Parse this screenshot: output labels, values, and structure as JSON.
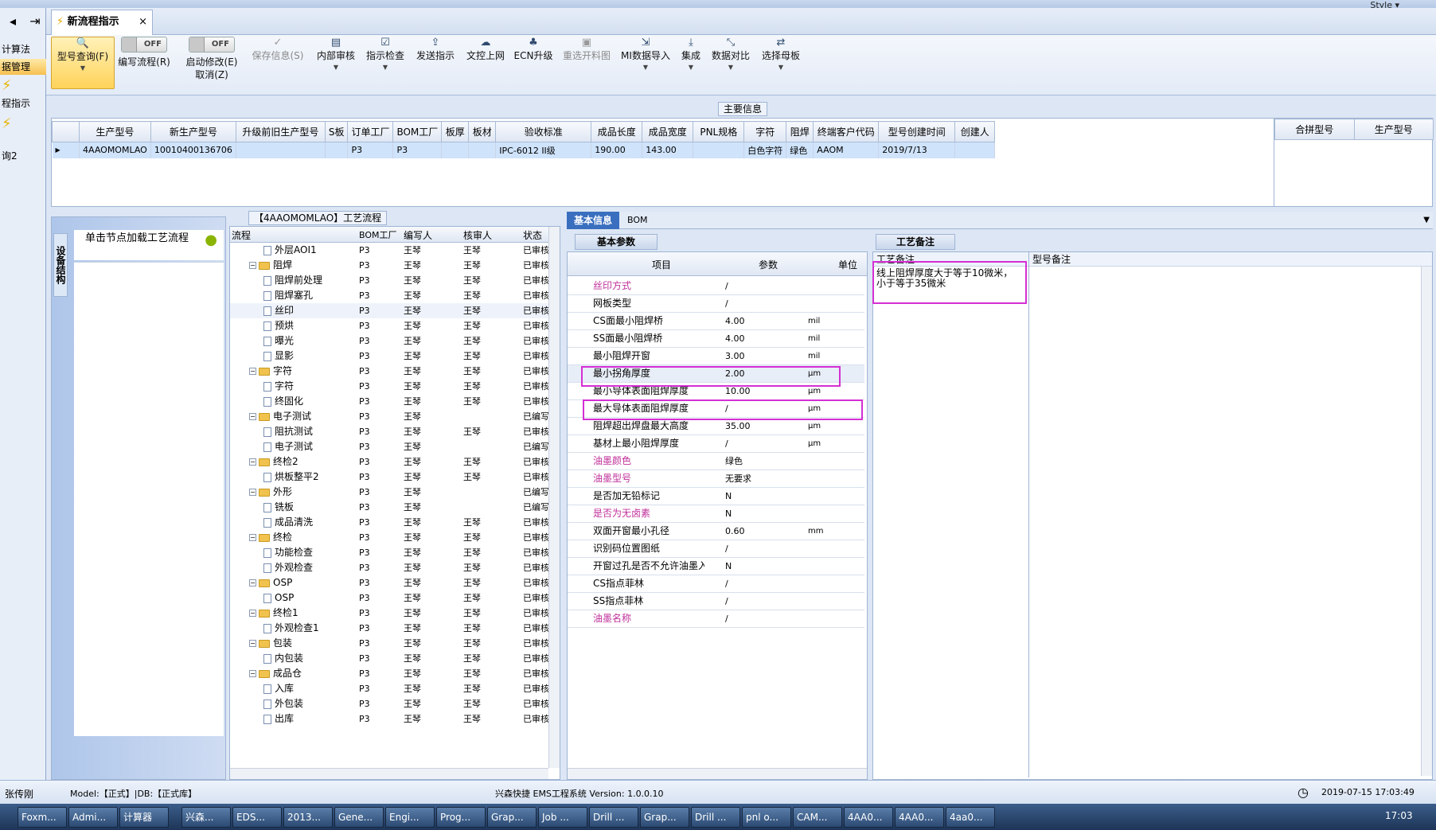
{
  "window": {
    "style_label": "Style ▾"
  },
  "leftnav": {
    "items": [
      "计算法",
      "据管理",
      "程指示",
      "询2"
    ],
    "icon_1": "lightning-icon",
    "icon_2": "lightning-icon"
  },
  "tabstrip": {
    "back": "◂",
    "forward": "⇥",
    "tab_label": "新流程指示",
    "close": "×"
  },
  "ribbon": {
    "query": "型号查询(F)",
    "write_flow": "编写流程(R)",
    "start_modify": "启动修改(E)",
    "cancel": "取消(Z)",
    "toggle_off": "OFF",
    "save": "保存信息(S)",
    "internal_review": "内部审核",
    "instr_check": "指示检查",
    "send_instr": "发送指示",
    "upload": "文控上网",
    "ecn": "ECN升级",
    "reselect": "重选开料图",
    "mi_import": "MI数据导入",
    "integrate": "集成",
    "data_compare": "数据对比",
    "select_board": "选择母板"
  },
  "main_info": {
    "title": "主要信息",
    "columns": [
      "生产型号",
      "新生产型号",
      "升级前旧生产型号",
      "S板",
      "订单工厂",
      "BOM工厂",
      "板厚",
      "板材",
      "验收标准",
      "成品长度",
      "成品宽度",
      "PNL规格",
      "字符",
      "阻焊",
      "终端客户代码",
      "型号创建时间",
      "创建人"
    ],
    "row": [
      "4AAOMOMLAO",
      "10010400136706",
      "",
      "",
      "P3",
      "P3",
      "",
      "",
      "IPC-6012 II级",
      "190.00",
      "143.00",
      "",
      "白色字符",
      "绿色",
      "AAOM",
      "2019/7/13",
      ""
    ],
    "side_columns": [
      "合拼型号",
      "生产型号"
    ]
  },
  "left_panel": {
    "vertical_tab": "设备结构",
    "load_label": "单击节点加载工艺流程"
  },
  "flow": {
    "title": "【4AAOMOMLAO】工艺流程",
    "columns": [
      "流程",
      "BOM工厂",
      "编写人",
      "核审人",
      "状态"
    ],
    "rows": [
      {
        "name": "外层AOI1",
        "lvl": 2,
        "f": "P3",
        "w": "王琴",
        "r": "王琴",
        "s": "已审核"
      },
      {
        "name": "阻焊",
        "lvl": 1,
        "f": "P3",
        "w": "王琴",
        "r": "王琴",
        "s": "已审核"
      },
      {
        "name": "阻焊前处理",
        "lvl": 2,
        "f": "P3",
        "w": "王琴",
        "r": "王琴",
        "s": "已审核"
      },
      {
        "name": "阻焊塞孔",
        "lvl": 2,
        "f": "P3",
        "w": "王琴",
        "r": "王琴",
        "s": "已审核"
      },
      {
        "name": "丝印",
        "lvl": 2,
        "f": "P3",
        "w": "王琴",
        "r": "王琴",
        "s": "已审核"
      },
      {
        "name": "预烘",
        "lvl": 2,
        "f": "P3",
        "w": "王琴",
        "r": "王琴",
        "s": "已审核"
      },
      {
        "name": "曝光",
        "lvl": 2,
        "f": "P3",
        "w": "王琴",
        "r": "王琴",
        "s": "已审核"
      },
      {
        "name": "显影",
        "lvl": 2,
        "f": "P3",
        "w": "王琴",
        "r": "王琴",
        "s": "已审核"
      },
      {
        "name": "字符",
        "lvl": 1,
        "f": "P3",
        "w": "王琴",
        "r": "王琴",
        "s": "已审核"
      },
      {
        "name": "字符",
        "lvl": 2,
        "f": "P3",
        "w": "王琴",
        "r": "王琴",
        "s": "已审核"
      },
      {
        "name": "终固化",
        "lvl": 2,
        "f": "P3",
        "w": "王琴",
        "r": "王琴",
        "s": "已审核"
      },
      {
        "name": "电子测试",
        "lvl": 1,
        "f": "P3",
        "w": "王琴",
        "r": "",
        "s": "已编写"
      },
      {
        "name": "阻抗测试",
        "lvl": 2,
        "f": "P3",
        "w": "王琴",
        "r": "王琴",
        "s": "已审核"
      },
      {
        "name": "电子测试",
        "lvl": 2,
        "f": "P3",
        "w": "王琴",
        "r": "",
        "s": "已编写"
      },
      {
        "name": "终检2",
        "lvl": 1,
        "f": "P3",
        "w": "王琴",
        "r": "王琴",
        "s": "已审核"
      },
      {
        "name": "烘板整平2",
        "lvl": 2,
        "f": "P3",
        "w": "王琴",
        "r": "王琴",
        "s": "已审核"
      },
      {
        "name": "外形",
        "lvl": 1,
        "f": "P3",
        "w": "王琴",
        "r": "",
        "s": "已编写"
      },
      {
        "name": "铣板",
        "lvl": 2,
        "f": "P3",
        "w": "王琴",
        "r": "",
        "s": "已编写"
      },
      {
        "name": "成品清洗",
        "lvl": 2,
        "f": "P3",
        "w": "王琴",
        "r": "王琴",
        "s": "已审核"
      },
      {
        "name": "终检",
        "lvl": 1,
        "f": "P3",
        "w": "王琴",
        "r": "王琴",
        "s": "已审核"
      },
      {
        "name": "功能检查",
        "lvl": 2,
        "f": "P3",
        "w": "王琴",
        "r": "王琴",
        "s": "已审核"
      },
      {
        "name": "外观检查",
        "lvl": 2,
        "f": "P3",
        "w": "王琴",
        "r": "王琴",
        "s": "已审核"
      },
      {
        "name": "OSP",
        "lvl": 1,
        "f": "P3",
        "w": "王琴",
        "r": "王琴",
        "s": "已审核"
      },
      {
        "name": "OSP",
        "lvl": 2,
        "f": "P3",
        "w": "王琴",
        "r": "王琴",
        "s": "已审核"
      },
      {
        "name": "终检1",
        "lvl": 1,
        "f": "P3",
        "w": "王琴",
        "r": "王琴",
        "s": "已审核"
      },
      {
        "name": "外观检查1",
        "lvl": 2,
        "f": "P3",
        "w": "王琴",
        "r": "王琴",
        "s": "已审核"
      },
      {
        "name": "包装",
        "lvl": 1,
        "f": "P3",
        "w": "王琴",
        "r": "王琴",
        "s": "已审核"
      },
      {
        "name": "内包装",
        "lvl": 2,
        "f": "P3",
        "w": "王琴",
        "r": "王琴",
        "s": "已审核"
      },
      {
        "name": "成品仓",
        "lvl": 1,
        "f": "P3",
        "w": "王琴",
        "r": "王琴",
        "s": "已审核"
      },
      {
        "name": "入库",
        "lvl": 2,
        "f": "P3",
        "w": "王琴",
        "r": "王琴",
        "s": "已审核"
      },
      {
        "name": "外包装",
        "lvl": 2,
        "f": "P3",
        "w": "王琴",
        "r": "王琴",
        "s": "已审核"
      },
      {
        "name": "出库",
        "lvl": 2,
        "f": "P3",
        "w": "王琴",
        "r": "王琴",
        "s": "已审核"
      }
    ]
  },
  "details": {
    "tab_basic": "基本信息",
    "tab_bom": "BOM",
    "params_title": "基本参数",
    "columns": [
      "项目",
      "参数",
      "单位"
    ],
    "rows": [
      {
        "item": "丝印方式",
        "param": "/",
        "unit": "",
        "pink": true
      },
      {
        "item": "网板类型",
        "param": "/",
        "unit": "",
        "pink": false
      },
      {
        "item": "CS面最小阻焊桥",
        "param": "4.00",
        "unit": "mil",
        "pink": false
      },
      {
        "item": "SS面最小阻焊桥",
        "param": "4.00",
        "unit": "mil",
        "pink": false
      },
      {
        "item": "最小阻焊开窗",
        "param": "3.00",
        "unit": "mil",
        "pink": false
      },
      {
        "item": "最小拐角厚度",
        "param": "2.00",
        "unit": "μm",
        "pink": false
      },
      {
        "item": "最小导体表面阻焊厚度",
        "param": "10.00",
        "unit": "μm",
        "pink": false
      },
      {
        "item": "最大导体表面阻焊厚度",
        "param": "/",
        "unit": "μm",
        "pink": false
      },
      {
        "item": "阻焊超出焊盘最大高度",
        "param": "35.00",
        "unit": "μm",
        "pink": false
      },
      {
        "item": "基材上最小阻焊厚度",
        "param": "/",
        "unit": "μm",
        "pink": false
      },
      {
        "item": "油墨颜色",
        "param": "绿色",
        "unit": "",
        "pink": true
      },
      {
        "item": "油墨型号",
        "param": "无要求",
        "unit": "",
        "pink": true
      },
      {
        "item": "是否加无铅标记",
        "param": "N",
        "unit": "",
        "pink": false
      },
      {
        "item": "是否为无卤素",
        "param": "N",
        "unit": "",
        "pink": true
      },
      {
        "item": "双面开窗最小孔径",
        "param": "0.60",
        "unit": "mm",
        "pink": false
      },
      {
        "item": "识别码位置图纸",
        "param": "/",
        "unit": "",
        "pink": false
      },
      {
        "item": "开窗过孔是否不允许油墨入孔",
        "param": "N",
        "unit": "",
        "pink": false
      },
      {
        "item": "CS指点菲林",
        "param": "/",
        "unit": "",
        "pink": false
      },
      {
        "item": "SS指点菲林",
        "param": "/",
        "unit": "",
        "pink": false
      },
      {
        "item": "油墨名称",
        "param": "/",
        "unit": "",
        "pink": true
      }
    ],
    "remarks_title": "工艺备注",
    "craft_remark_label": "工艺备注",
    "craft_remark_text": "线上阻焊厚度大于等于10微米，小于等于35微米",
    "model_remark_label": "型号备注"
  },
  "status": {
    "user": "张传刚",
    "model_db": "Model:【正式】|DB:【正式库】",
    "app": "兴森快捷 EMS工程系统 Version: 1.0.0.10",
    "datetime": "2019-07-15 17:03:49"
  },
  "taskbar": {
    "items": [
      "Foxm...",
      "Admi...",
      "计算器",
      "兴森...",
      "EDS...",
      "2013...",
      "Gene...",
      "Engi...",
      "Prog...",
      "Grap...",
      "Job ...",
      "Drill ...",
      "Grap...",
      "Drill ...",
      "pnl o...",
      "CAM...",
      "4AA0...",
      "4AA0...",
      "4aa0..."
    ],
    "time": "17:03"
  },
  "colors": {
    "accent": "#3a6fbf",
    "highlight": "#d42fd4",
    "pink": "#c0309a",
    "row_sel": "#cfe3fb"
  }
}
